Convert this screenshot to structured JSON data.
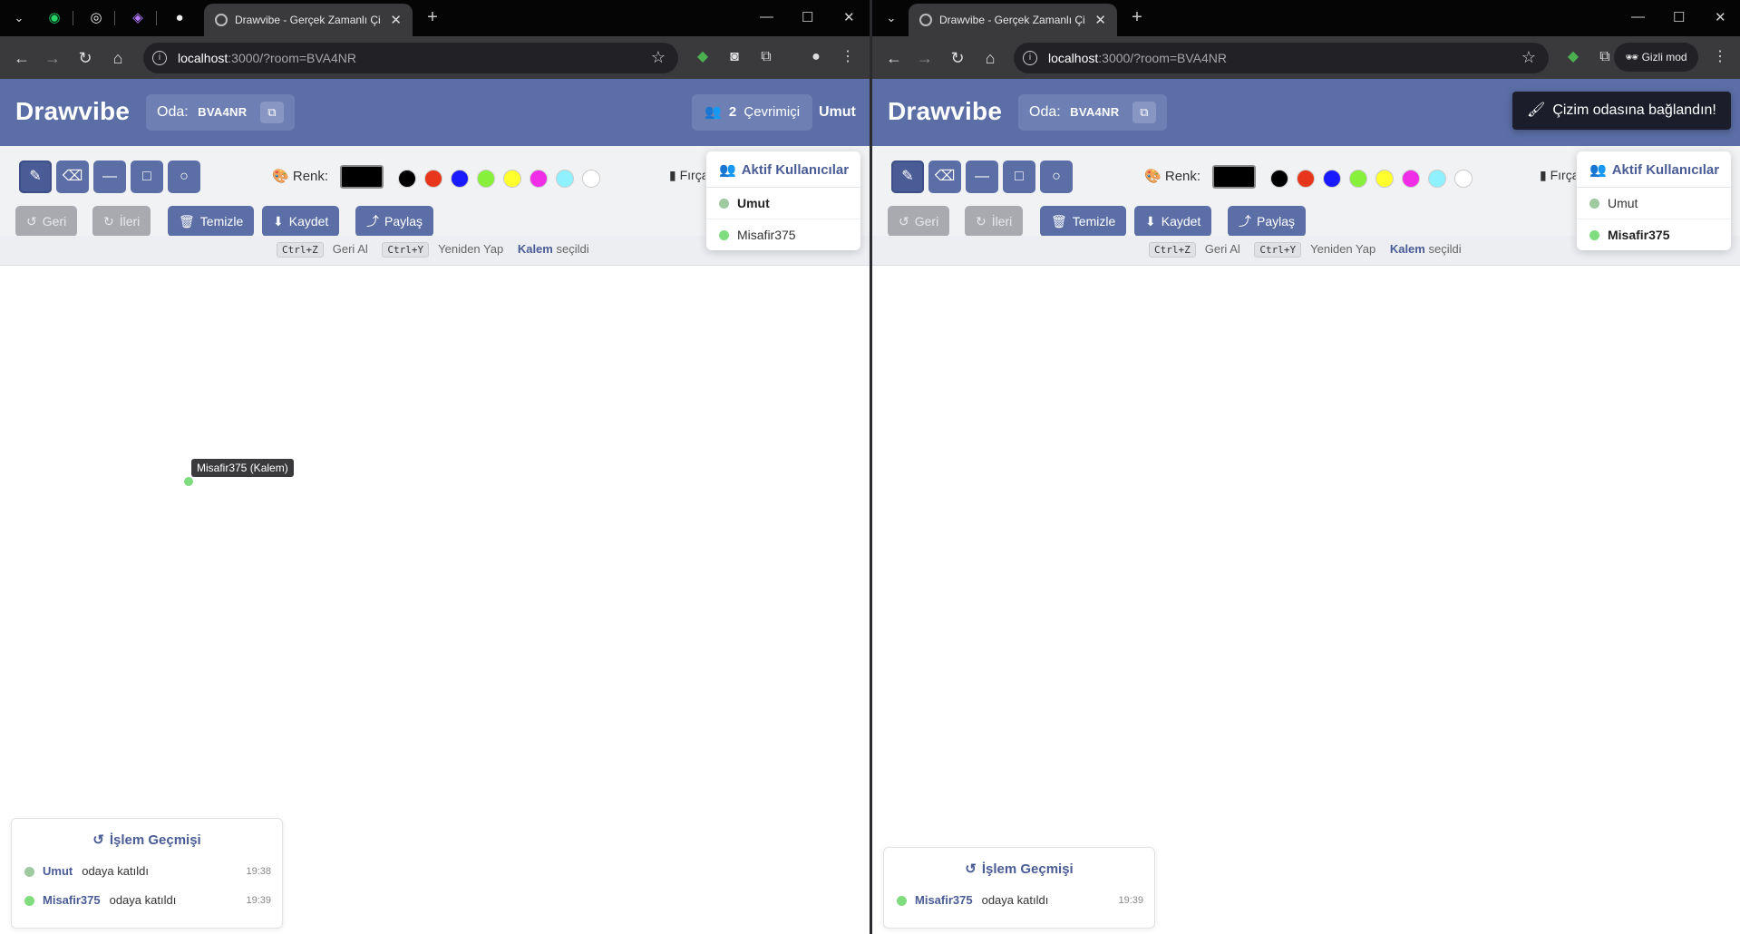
{
  "browser_left": {
    "tab_title": "Drawvibe - Gerçek Zamanlı Çizim",
    "url_host": "localhost",
    "url_path": ":3000/?room=BVA4NR"
  },
  "browser_right": {
    "tab_title": "Drawvibe - Gerçek Zamanlı Çizim",
    "url_host": "localhost",
    "url_path": ":3000/?room=BVA4NR",
    "incognito_label": "Gizli mod"
  },
  "app": {
    "logo": "Drawvibe",
    "room_label": "Oda:",
    "room_code": "BVA4NR",
    "online_count": "2",
    "online_label": "Çevrimiçi",
    "current_user_left": "Umut",
    "toast": "Çizim odasına bağlandın!",
    "color_label": "Renk:",
    "brush_label": "Fırça",
    "palette": [
      "#000000",
      "#e8361c",
      "#1a1aff",
      "#86f03a",
      "#ffff2e",
      "#f02ee8",
      "#8ff0ff",
      "#ffffff"
    ],
    "actions": {
      "undo": "Geri",
      "redo": "İleri",
      "clear": "Temizle",
      "save": "Kaydet",
      "share": "Paylaş"
    },
    "shortcuts": {
      "undo_key": "Ctrl+Z",
      "undo_text": "Geri Al",
      "redo_key": "Ctrl+Y",
      "redo_text": "Yeniden Yap",
      "selected_tool": "Kalem",
      "selected_suffix": "seçildi"
    },
    "active_users": {
      "title": "Aktif Kullanıcılar",
      "users": [
        "Umut",
        "Misafir375"
      ]
    },
    "cursor_label": "Misafir375 (Kalem)",
    "history": {
      "title": "İşlem Geçmişi",
      "left_entries": [
        {
          "user": "Umut",
          "action": "odaya katıldı",
          "time": "19:38"
        },
        {
          "user": "Misafir375",
          "action": "odaya katıldı",
          "time": "19:39"
        }
      ],
      "right_entries": [
        {
          "user": "Misafir375",
          "action": "odaya katıldı",
          "time": "19:39"
        }
      ]
    },
    "colors": {
      "header": "#5b6ea6",
      "accent": "#4a5c95",
      "online_dot": "#7fdc7f",
      "offline_dot": "#9fc99f"
    }
  }
}
